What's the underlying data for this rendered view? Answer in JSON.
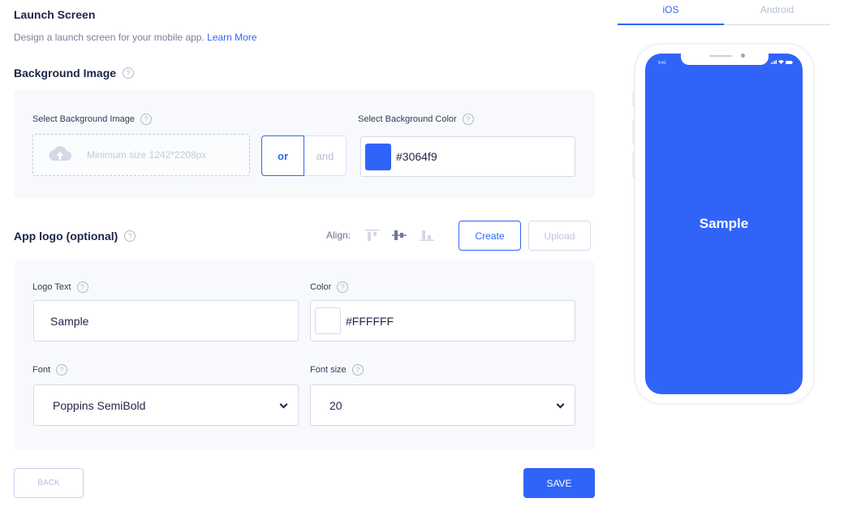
{
  "header": {
    "title": "Launch Screen",
    "subtitle": "Design a launch screen for your mobile app.",
    "learn_more": "Learn More"
  },
  "background_image": {
    "section_title": "Background Image",
    "select_image_label": "Select Background Image",
    "upload_hint": "Minimum size 1242*2208px",
    "toggle_options": [
      "or",
      "and"
    ],
    "toggle_selected": "or",
    "select_color_label": "Select Background Color",
    "color_value": "#3064f9"
  },
  "app_logo": {
    "section_title": "App logo (optional)",
    "align_label": "Align:",
    "align_options": [
      "align-top",
      "align-center",
      "align-bottom"
    ],
    "create_label": "Create",
    "upload_label": "Upload",
    "logo_text_label": "Logo Text",
    "logo_text_value": "Sample",
    "color_label": "Color",
    "color_value": "#FFFFFF",
    "font_label": "Font",
    "font_value": "Poppins SemiBold",
    "font_size_label": "Font size",
    "font_size_value": "20"
  },
  "footer": {
    "back_label": "BACK",
    "save_label": "SAVE"
  },
  "preview": {
    "tabs": [
      {
        "label": "iOS",
        "active": true
      },
      {
        "label": "Android",
        "active": false
      }
    ],
    "status_time": "9:41",
    "logo_text": "Sample",
    "background_color": "#3064f9",
    "text_color": "#FFFFFF"
  },
  "help_icon_glyph": "?"
}
